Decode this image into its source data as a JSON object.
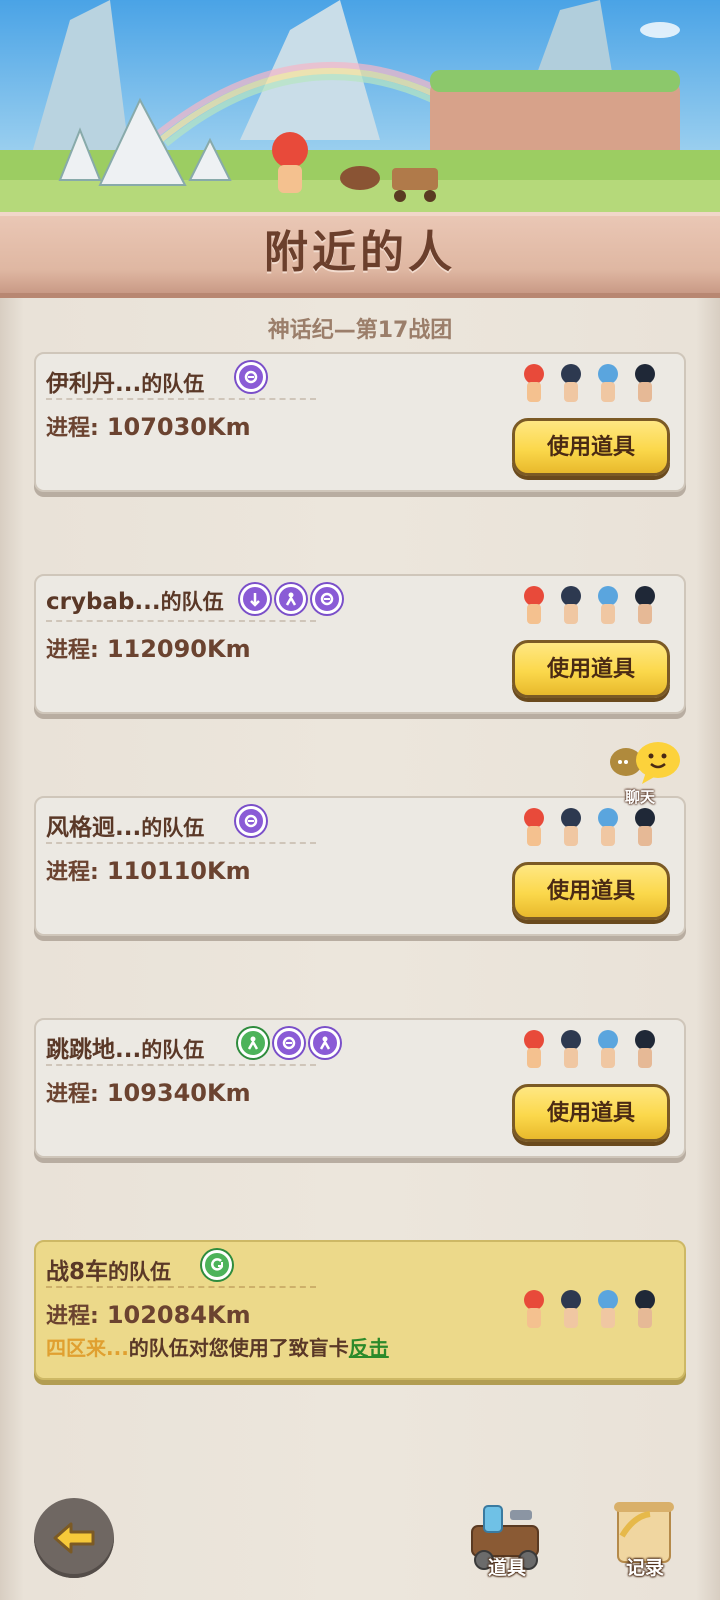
{
  "header": {
    "title": "附近的人"
  },
  "guild": {
    "name": "神话纪—第17战团"
  },
  "teams": [
    {
      "name": "伊利丹...",
      "suffix": "的队伍",
      "progress_label": "进程:",
      "progress": "107030Km",
      "action_label": "使用道具",
      "badges": [
        "purple"
      ]
    },
    {
      "name": "crybab...",
      "suffix": "的队伍",
      "progress_label": "进程:",
      "progress": "112090Km",
      "action_label": "使用道具",
      "badges": [
        "purple",
        "purple",
        "purple"
      ]
    },
    {
      "name": "风格迥...",
      "suffix": "的队伍",
      "progress_label": "进程:",
      "progress": "110110Km",
      "action_label": "使用道具",
      "badges": [
        "purple"
      ]
    },
    {
      "name": "跳跳地...",
      "suffix": "的队伍",
      "progress_label": "进程:",
      "progress": "109340Km",
      "action_label": "使用道具",
      "badges": [
        "green",
        "purple",
        "purple"
      ]
    }
  ],
  "my_team": {
    "name": "战8车",
    "suffix": "的队伍",
    "progress_label": "进程:",
    "progress": "102084Km",
    "notice_source": "四区来...",
    "notice_text": "的队伍对您使用了致盲卡",
    "notice_action": "反击",
    "badges": [
      "green"
    ]
  },
  "chat": {
    "label": "聊天"
  },
  "bottom_bar": {
    "items_label": "道具",
    "records_label": "记录"
  },
  "colors": {
    "accent_yellow": "#fbd84b",
    "badge_purple": "#8a5bd6",
    "badge_green": "#4db35a",
    "title_brown": "#6b3f2c"
  }
}
